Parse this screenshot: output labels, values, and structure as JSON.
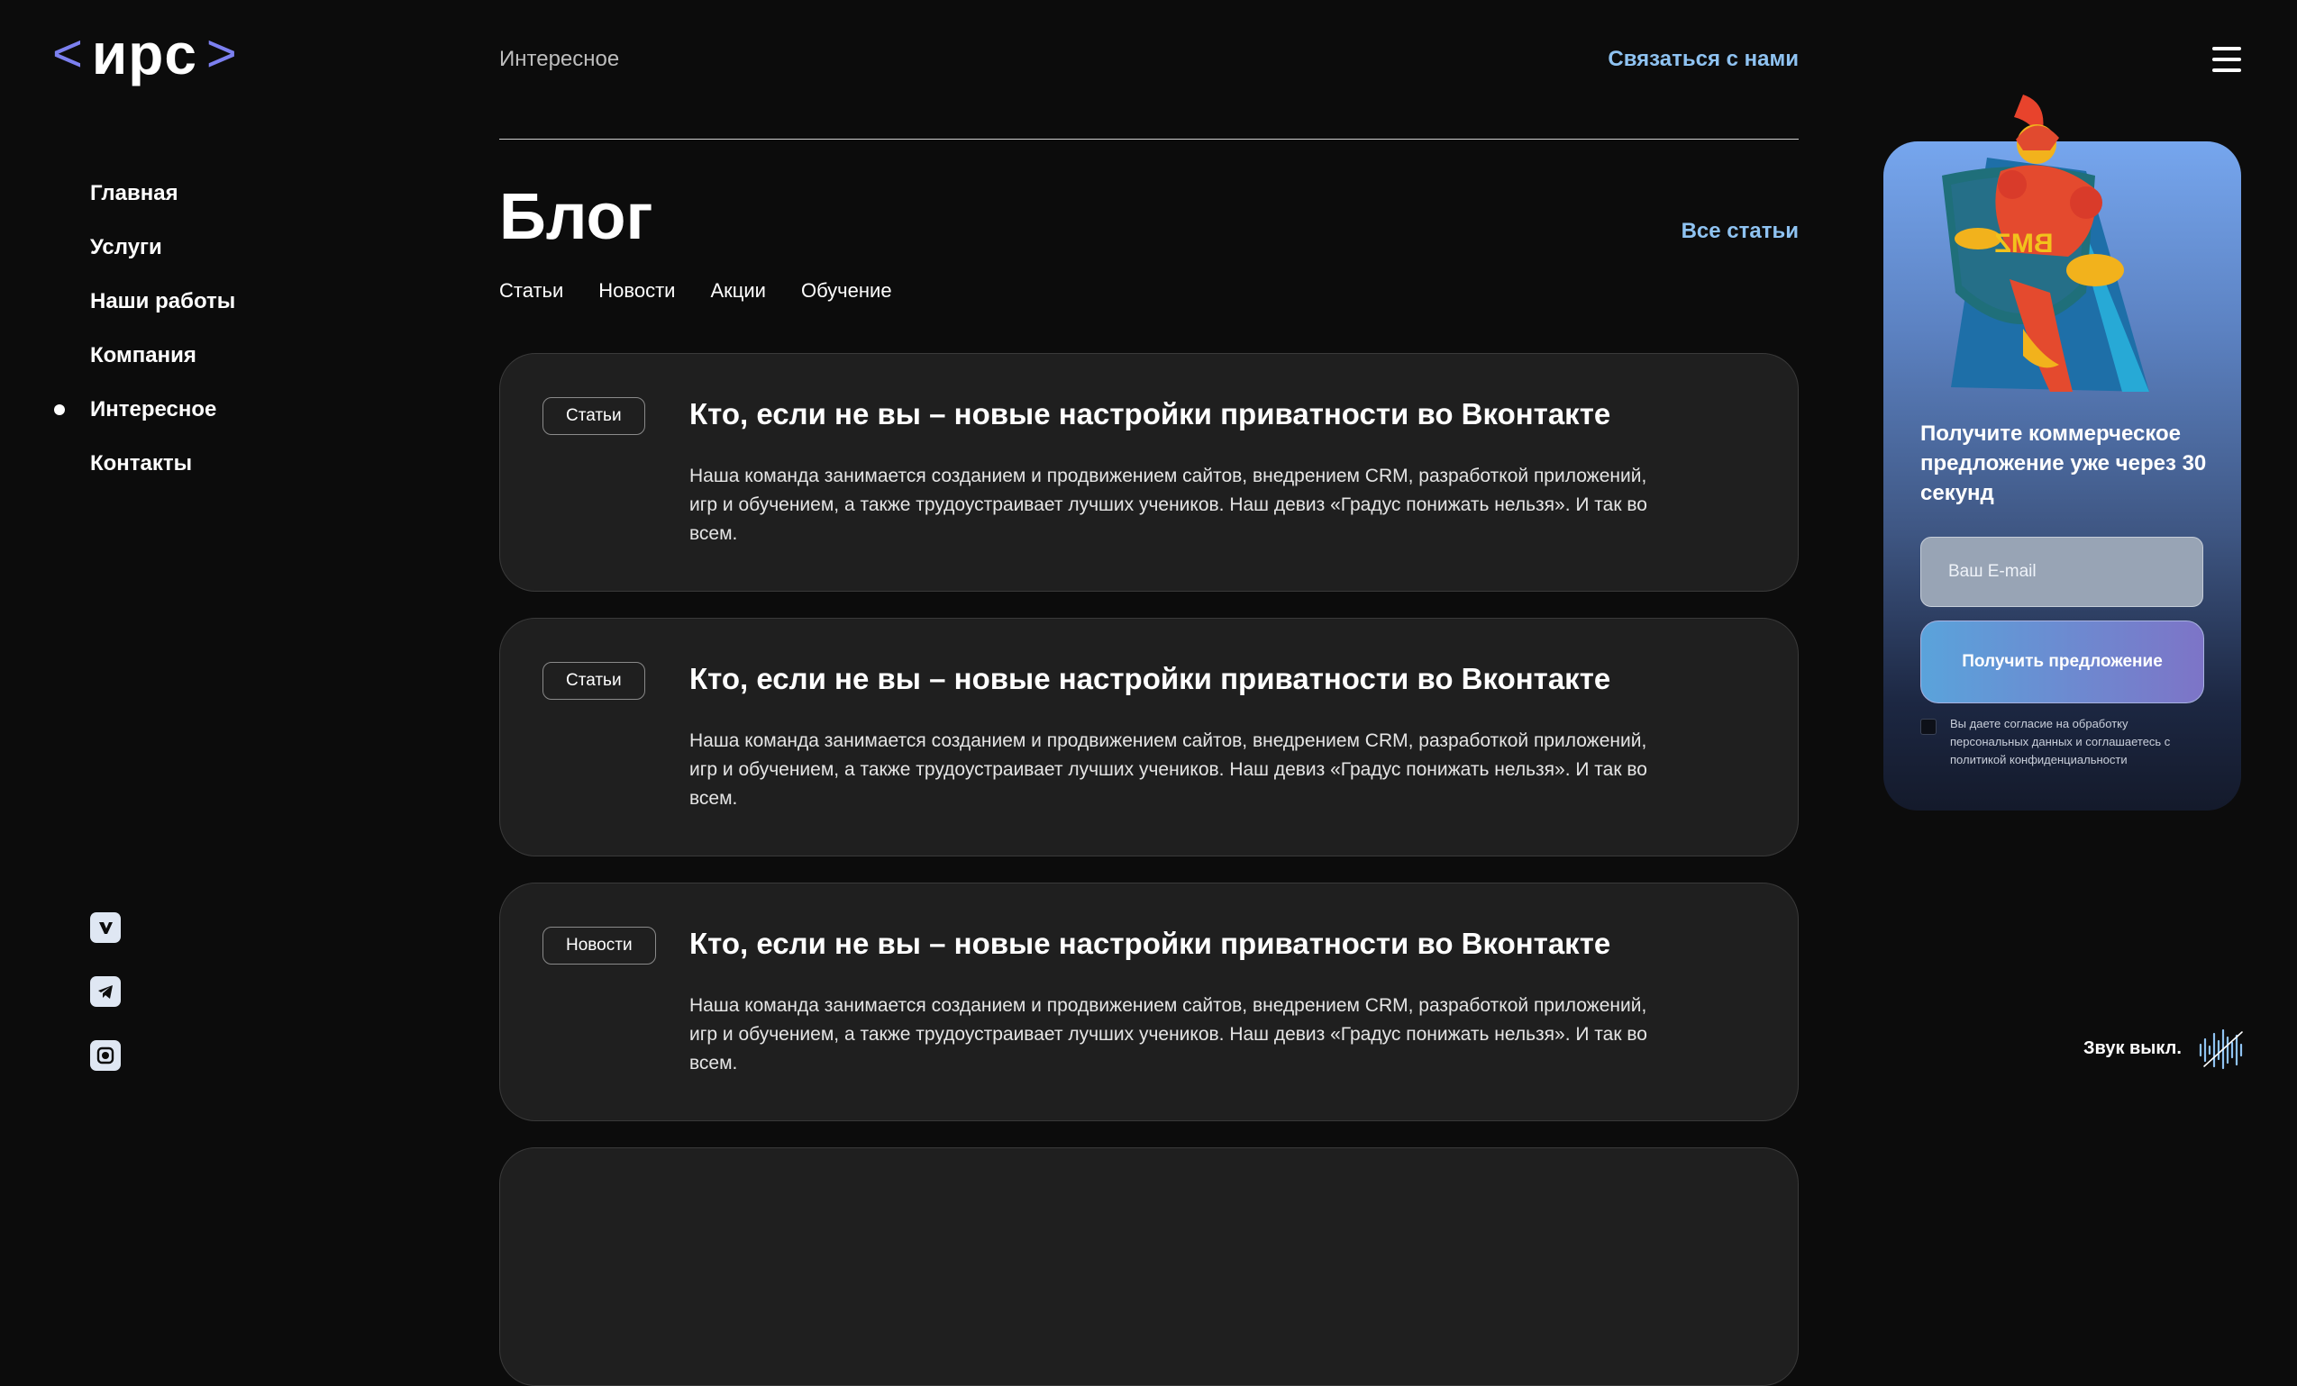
{
  "logo": {
    "left": "<",
    "word": "ирс",
    "right": ">"
  },
  "nav": {
    "items": [
      {
        "label": "Главная"
      },
      {
        "label": "Услуги"
      },
      {
        "label": "Наши работы"
      },
      {
        "label": "Компания"
      },
      {
        "label": "Интересное",
        "active": true
      },
      {
        "label": "Контакты"
      }
    ]
  },
  "socials": [
    {
      "icon": "vk-icon"
    },
    {
      "icon": "telegram-icon"
    },
    {
      "icon": "instagram-icon"
    }
  ],
  "header": {
    "section_title": "Интересное",
    "contact_link": "Связаться с нами"
  },
  "blog": {
    "title": "Блог",
    "all_articles": "Все статьи",
    "tabs": [
      "Статьи",
      "Новости",
      "Акции",
      "Обучение"
    ],
    "cards": [
      {
        "badge": "Статьи",
        "title": "Кто, если не вы – новые настройки приватности во Вконтакте",
        "text": "Наша команда занимается созданием и продвижением сайтов, внедрением CRM, разработкой приложений, игр и обучением, а также трудоустраивает лучших учеников. Наш девиз «Градус понижать нельзя». И так во всем."
      },
      {
        "badge": "Статьи",
        "title": "Кто, если не вы – новые настройки приватности во Вконтакте",
        "text": "Наша команда занимается созданием и продвижением сайтов, внедрением CRM, разработкой приложений, игр и обучением, а также трудоустраивает лучших учеников. Наш девиз «Градус понижать нельзя». И так во всем."
      },
      {
        "badge": "Новости",
        "title": "Кто, если не вы – новые настройки приватности во Вконтакте",
        "text": "Наша команда занимается созданием и продвижением сайтов, внедрением CRM, разработкой приложений, игр и обучением, а также трудоустраивает лучших учеников. Наш девиз «Градус понижать нельзя». И так во всем."
      }
    ]
  },
  "promo": {
    "mascot_shield_text": "BMZ",
    "title": "Получите коммерческое предложение уже через 30 секунд",
    "email_placeholder": "Ваш E-mail",
    "button": "Получить предложение",
    "consent": "Вы даете согласие на обработку персональных данных и соглашаетесь с политикой конфиденциальности"
  },
  "sound": {
    "label": "Звук выкл."
  },
  "colors": {
    "accent": "#8fc3f2",
    "logo_chevron": "#7c80f0",
    "card_bg": "#1f1f1f",
    "page_bg": "#0c0c0c"
  }
}
